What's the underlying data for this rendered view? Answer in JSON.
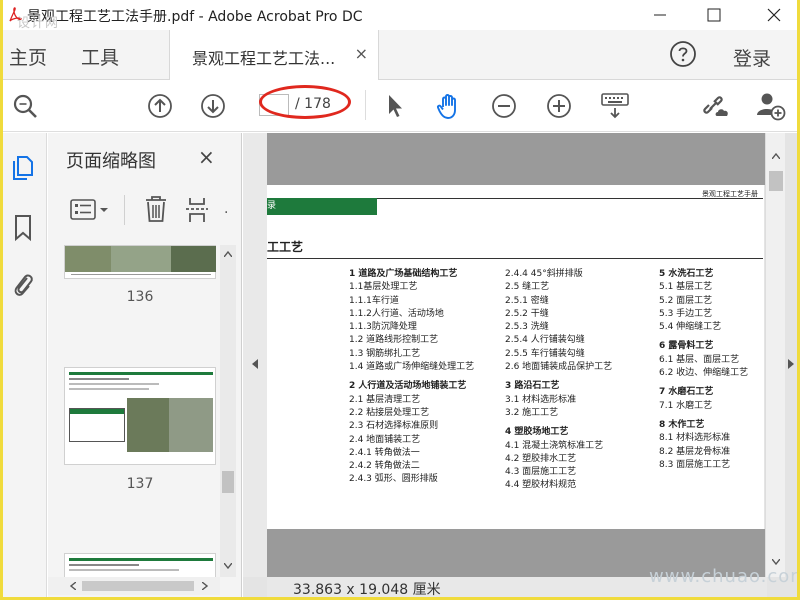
{
  "window": {
    "title": "景观工程工艺工法手册.pdf - Adobe Acrobat Pro DC",
    "watermark_top": "设计网"
  },
  "tabs": {
    "home": "主页",
    "tools": "工具",
    "document": "景观工程工艺工法...",
    "close": "×",
    "login": "登录"
  },
  "toolbar": {
    "current_page": "",
    "page_total": "/ 178"
  },
  "panel": {
    "title": "页面缩略图",
    "close": "×",
    "thumbs": [
      {
        "label": "136"
      },
      {
        "label": "137"
      }
    ]
  },
  "page": {
    "header_right": "景观工程工艺手册",
    "band_text": "录",
    "section_title": "工工艺",
    "toc_col1": [
      {
        "t": "1 道路及广场基础结构工艺",
        "h": true
      },
      {
        "t": "1.1基层处理工艺"
      },
      {
        "t": "1.1.1车行道"
      },
      {
        "t": "1.1.2人行道、活动场地"
      },
      {
        "t": "1.1.3防沉降处理"
      },
      {
        "t": "1.2 道路线形控制工艺"
      },
      {
        "t": "1.3 钢筋绑扎工艺"
      },
      {
        "t": "1.4 道路或广场伸缩缝处理工艺"
      },
      {
        "t": "",
        "gap": true
      },
      {
        "t": "2 人行道及活动场地铺装工艺",
        "h": true
      },
      {
        "t": "2.1 基层清理工艺"
      },
      {
        "t": "2.2 粘接层处理工艺"
      },
      {
        "t": "2.3 石材选择标准原则"
      },
      {
        "t": "2.4 地面铺装工艺"
      },
      {
        "t": "2.4.1 转角做法一"
      },
      {
        "t": "2.4.2 转角做法二"
      },
      {
        "t": "2.4.3 弧形、圆形排版"
      }
    ],
    "toc_col2": [
      {
        "t": "2.4.4  45°斜拼排版"
      },
      {
        "t": "2.5  缝工艺"
      },
      {
        "t": "2.5.1  密缝"
      },
      {
        "t": "2.5.2  干缝"
      },
      {
        "t": "2.5.3  洗缝"
      },
      {
        "t": "2.5.4  人行铺装勾缝"
      },
      {
        "t": "2.5.5  车行铺装勾缝"
      },
      {
        "t": "2.6  地面铺装成品保护工艺"
      },
      {
        "t": "",
        "gap": true
      },
      {
        "t": "3 路沿石工艺",
        "h": true
      },
      {
        "t": "3.1  材料选形标准"
      },
      {
        "t": "3.2  施工工艺"
      },
      {
        "t": "",
        "gap": true
      },
      {
        "t": "4 塑胶场地工艺",
        "h": true
      },
      {
        "t": "4.1 混凝土浇筑标准工艺"
      },
      {
        "t": "4.2 塑胶排水工艺"
      },
      {
        "t": "4.3 面层施工工艺"
      },
      {
        "t": "4.4 塑胶材料规范"
      }
    ],
    "toc_col3": [
      {
        "t": "5 水洗石工艺",
        "h": true
      },
      {
        "t": "5.1 基层工艺"
      },
      {
        "t": "5.2 面层工艺"
      },
      {
        "t": "5.3 手边工艺"
      },
      {
        "t": "5.4 伸缩缝工艺"
      },
      {
        "t": "",
        "gap": true
      },
      {
        "t": "6 露骨料工艺",
        "h": true
      },
      {
        "t": "6.1 基层、面层工艺"
      },
      {
        "t": "6.2 收边、伸缩缝工艺"
      },
      {
        "t": "",
        "gap": true
      },
      {
        "t": "7 水磨石工艺",
        "h": true
      },
      {
        "t": "7.1 水磨工艺"
      },
      {
        "t": "",
        "gap": true
      },
      {
        "t": "8 木作工艺",
        "h": true
      },
      {
        "t": "8.1 材料选形标准"
      },
      {
        "t": "8.2 基层龙骨标准"
      },
      {
        "t": "8.3 面层施工工艺"
      }
    ]
  },
  "status": {
    "dimensions": "33.863 x 19.048 厘米"
  },
  "watermark_bottom": "www.chuao.com",
  "colors": {
    "frame": "#f0db3c",
    "accent_blue": "#1473e6",
    "green": "#1e7a3c",
    "annotation_red": "#e0281e"
  }
}
